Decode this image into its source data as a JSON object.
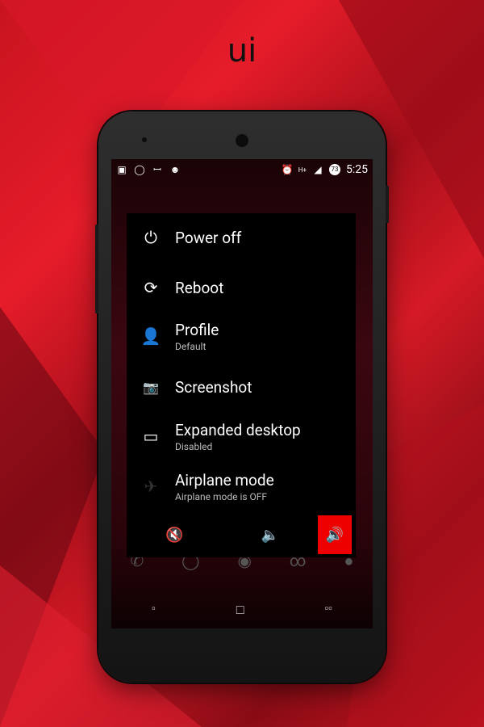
{
  "title": "ui",
  "status": {
    "time": "5:25",
    "battery": "73",
    "network": "H+"
  },
  "menu": [
    {
      "icon": "power-icon",
      "label": "Power off"
    },
    {
      "icon": "reboot-icon",
      "label": "Reboot"
    },
    {
      "icon": "profile-icon",
      "label": "Profile",
      "sub": "Default"
    },
    {
      "icon": "camera-icon",
      "label": "Screenshot"
    },
    {
      "icon": "expanded-desktop-icon",
      "label": "Expanded desktop",
      "sub": "Disabled"
    },
    {
      "icon": "airplane-icon",
      "label": "Airplane mode",
      "sub": "Airplane mode is OFF"
    }
  ],
  "volume": {
    "selected": "sound-on",
    "accent": "#ee0000"
  }
}
